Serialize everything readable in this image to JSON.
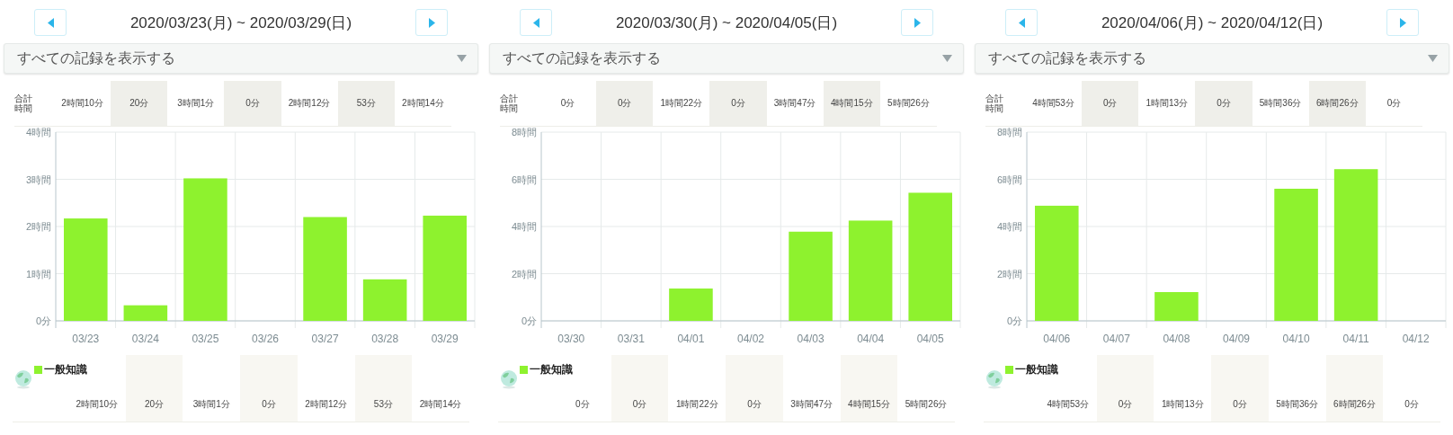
{
  "weeks": [
    {
      "range": "2020/03/23(月) ~ 2020/03/29(日)",
      "filter": "すべての記録を表示する",
      "total_label": "合計時間",
      "totals": [
        "2時間10分",
        "20分",
        "3時間1分",
        "0分",
        "2時間12分",
        "53分",
        "2時間14分"
      ],
      "chart_data": {
        "type": "bar",
        "grid": true,
        "categories": [
          "03/23",
          "03/24",
          "03/25",
          "03/26",
          "03/27",
          "03/28",
          "03/29"
        ],
        "series": [
          {
            "name": "一般知識",
            "color": "#8ef22e",
            "values": [
              2.17,
              0.33,
              3.02,
              0,
              2.2,
              0.88,
              2.23
            ]
          }
        ],
        "ylim": [
          0,
          4
        ],
        "yticks": [
          {
            "value": 0,
            "label": "0分"
          },
          {
            "value": 1,
            "label": "1時間"
          },
          {
            "value": 2,
            "label": "2時間"
          },
          {
            "value": 3,
            "label": "3時間"
          },
          {
            "value": 4,
            "label": "4時間"
          }
        ]
      },
      "subject_times": [
        "2時間10分",
        "20分",
        "3時間1分",
        "0分",
        "2時間12分",
        "53分",
        "2時間14分"
      ]
    },
    {
      "range": "2020/03/30(月) ~ 2020/04/05(日)",
      "filter": "すべての記録を表示する",
      "total_label": "合計時間",
      "totals": [
        "0分",
        "0分",
        "1時間22分",
        "0分",
        "3時間47分",
        "4時間15分",
        "5時間26分"
      ],
      "chart_data": {
        "type": "bar",
        "grid": true,
        "categories": [
          "03/30",
          "03/31",
          "04/01",
          "04/02",
          "04/03",
          "04/04",
          "04/05"
        ],
        "series": [
          {
            "name": "一般知識",
            "color": "#8ef22e",
            "values": [
              0,
              0,
              1.37,
              0,
              3.78,
              4.25,
              5.43
            ]
          }
        ],
        "ylim": [
          0,
          8
        ],
        "yticks": [
          {
            "value": 0,
            "label": "0分"
          },
          {
            "value": 2,
            "label": "2時間"
          },
          {
            "value": 4,
            "label": "4時間"
          },
          {
            "value": 6,
            "label": "6時間"
          },
          {
            "value": 8,
            "label": "8時間"
          }
        ]
      },
      "subject_times": [
        "0分",
        "0分",
        "1時間22分",
        "0分",
        "3時間47分",
        "4時間15分",
        "5時間26分"
      ]
    },
    {
      "range": "2020/04/06(月) ~ 2020/04/12(日)",
      "filter": "すべての記録を表示する",
      "total_label": "合計時間",
      "totals": [
        "4時間53分",
        "0分",
        "1時間13分",
        "0分",
        "5時間36分",
        "6時間26分",
        "0分"
      ],
      "chart_data": {
        "type": "bar",
        "grid": true,
        "categories": [
          "04/06",
          "04/07",
          "04/08",
          "04/09",
          "04/10",
          "04/11",
          "04/12"
        ],
        "series": [
          {
            "name": "一般知識",
            "color": "#8ef22e",
            "values": [
              4.88,
              0,
              1.22,
              0,
              5.6,
              6.43,
              0
            ]
          }
        ],
        "ylim": [
          0,
          8
        ],
        "yticks": [
          {
            "value": 0,
            "label": "0分"
          },
          {
            "value": 2,
            "label": "2時間"
          },
          {
            "value": 4,
            "label": "4時間"
          },
          {
            "value": 6,
            "label": "6時間"
          },
          {
            "value": 8,
            "label": "8時間"
          }
        ]
      },
      "subject_times": [
        "4時間53分",
        "0分",
        "1時間13分",
        "0分",
        "5時間36分",
        "6時間26分",
        "0分"
      ]
    }
  ]
}
